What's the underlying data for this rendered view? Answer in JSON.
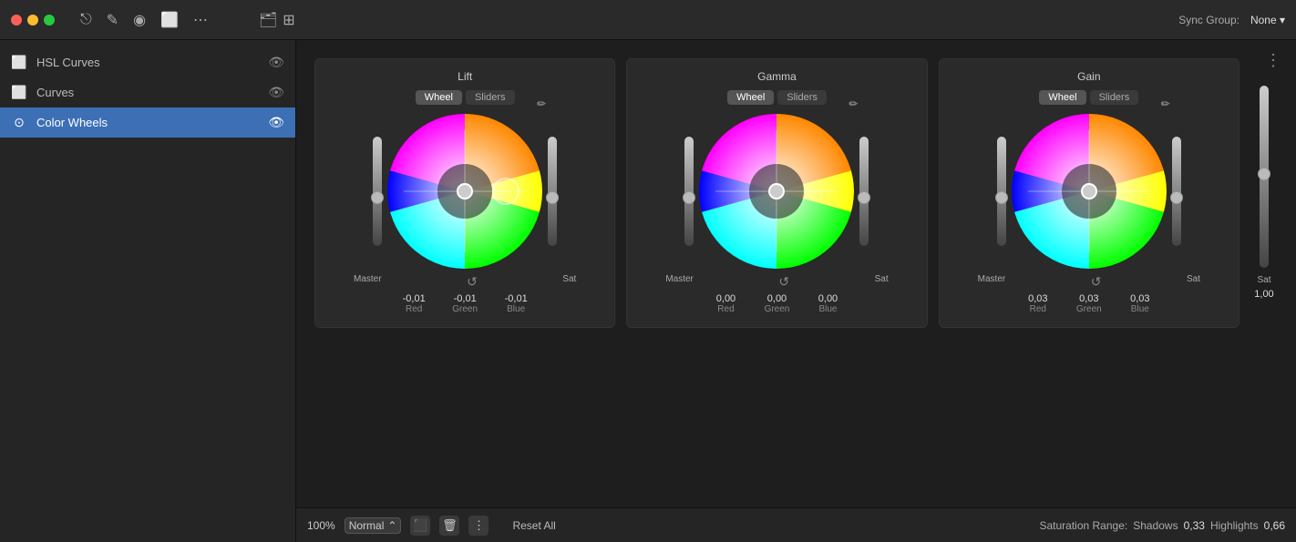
{
  "titlebar": {
    "sync_group_label": "Sync Group:",
    "sync_group_value": "None ▾"
  },
  "sidebar": {
    "items": [
      {
        "id": "hsl-curves",
        "label": "HSL Curves",
        "icon": "⬜",
        "active": false
      },
      {
        "id": "curves",
        "label": "Curves",
        "icon": "⬜",
        "active": false
      },
      {
        "id": "color-wheels",
        "label": "Color Wheels",
        "icon": "⊙",
        "active": true
      }
    ]
  },
  "panels": {
    "lift": {
      "title": "Lift",
      "tabs": [
        "Wheel",
        "Sliders"
      ],
      "active_tab": "Wheel",
      "red": "-0,01",
      "green": "-0,01",
      "blue": "-0,01",
      "master_label": "Master",
      "sat_label": "Sat",
      "red_label": "Red",
      "green_label": "Green",
      "blue_label": "Blue"
    },
    "gamma": {
      "title": "Gamma",
      "tabs": [
        "Wheel",
        "Sliders"
      ],
      "active_tab": "Wheel",
      "red": "0,00",
      "green": "0,00",
      "blue": "0,00",
      "master_label": "Master",
      "sat_label": "Sat",
      "red_label": "Red",
      "green_label": "Green",
      "blue_label": "Blue"
    },
    "gain": {
      "title": "Gain",
      "tabs": [
        "Wheel",
        "Sliders"
      ],
      "active_tab": "Wheel",
      "red": "0,03",
      "green": "0,03",
      "blue": "0,03",
      "master_label": "Master",
      "sat_label": "Sat",
      "red_label": "Red",
      "green_label": "Green",
      "blue_label": "Blue"
    }
  },
  "footer": {
    "zoom": "100%",
    "blend_mode": "Normal",
    "reset_all": "Reset All",
    "saturation_range_label": "Saturation Range:",
    "shadows_label": "Shadows",
    "shadows_value": "0,33",
    "highlights_label": "Highlights",
    "highlights_value": "0,66",
    "sat_value": "1,00"
  }
}
